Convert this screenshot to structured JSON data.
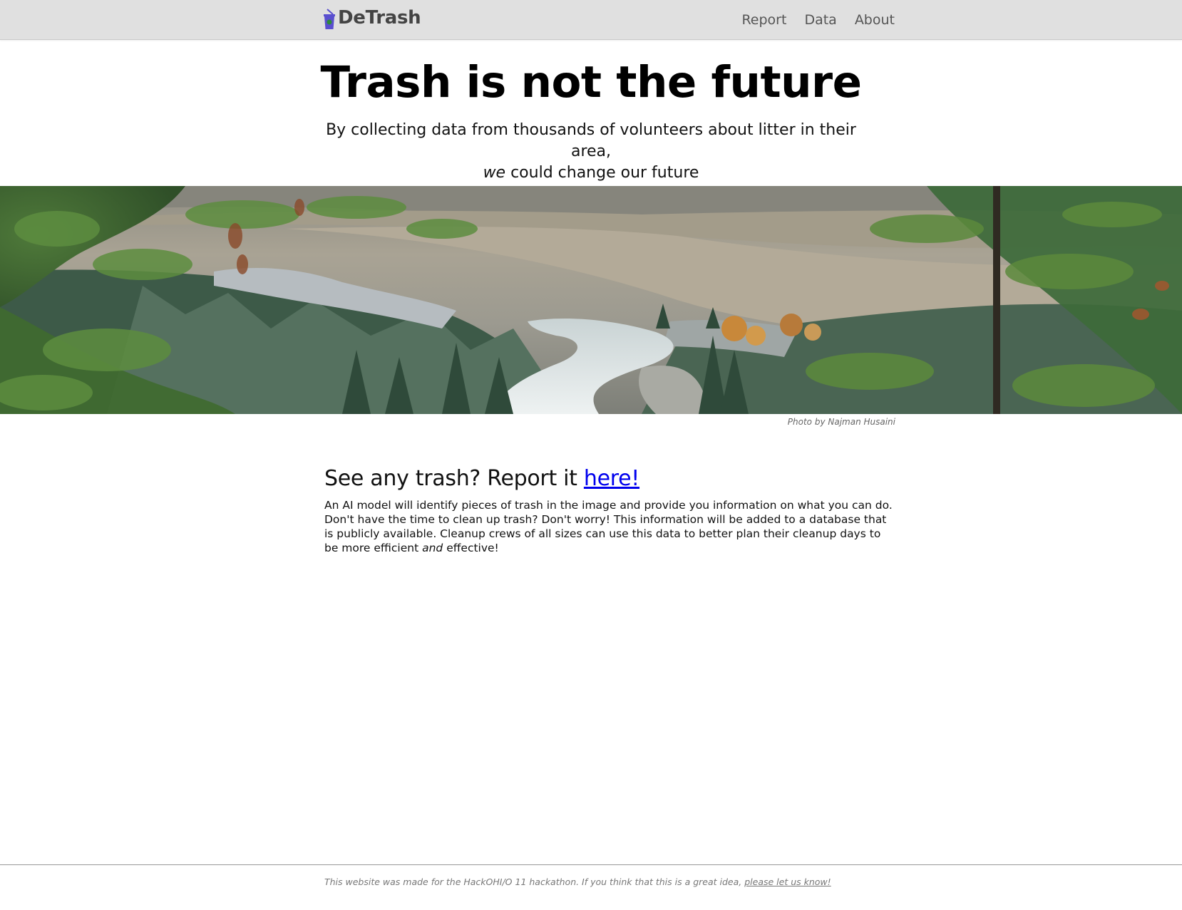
{
  "navbar": {
    "brand": "DeTrash",
    "links": [
      {
        "label": "Report"
      },
      {
        "label": "Data"
      },
      {
        "label": "About"
      }
    ]
  },
  "hero": {
    "title": "Trash is not the future",
    "subtitle_line1": "By collecting data from thousands of volunteers about litter in their area,",
    "subtitle_em": "we",
    "subtitle_line2_rest": " could change our future"
  },
  "banner": {
    "credit": "Photo by Najman Husaini"
  },
  "report": {
    "heading_prefix": "See any trash? Report it ",
    "heading_link": "here!",
    "body_part1": "An AI model will identify pieces of trash in the image and provide you information on what you can do. Don't have the time to clean up trash? Don't worry! This information will be added to a database that is publicly available. Cleanup crews of all sizes can use this data to better plan their cleanup days to be more efficient ",
    "body_em": "and",
    "body_part2": " effective!"
  },
  "footer": {
    "text": "This website was made for the HackOHI/O 11 hackathon. If you think that this is a great idea, ",
    "link": "please let us know!"
  },
  "colors": {
    "navbar_bg": "#e0e0e0",
    "brand_icon": "#5a4fcf",
    "link": "#0000ee"
  },
  "icons": {
    "brand": "trash-cup-icon"
  }
}
